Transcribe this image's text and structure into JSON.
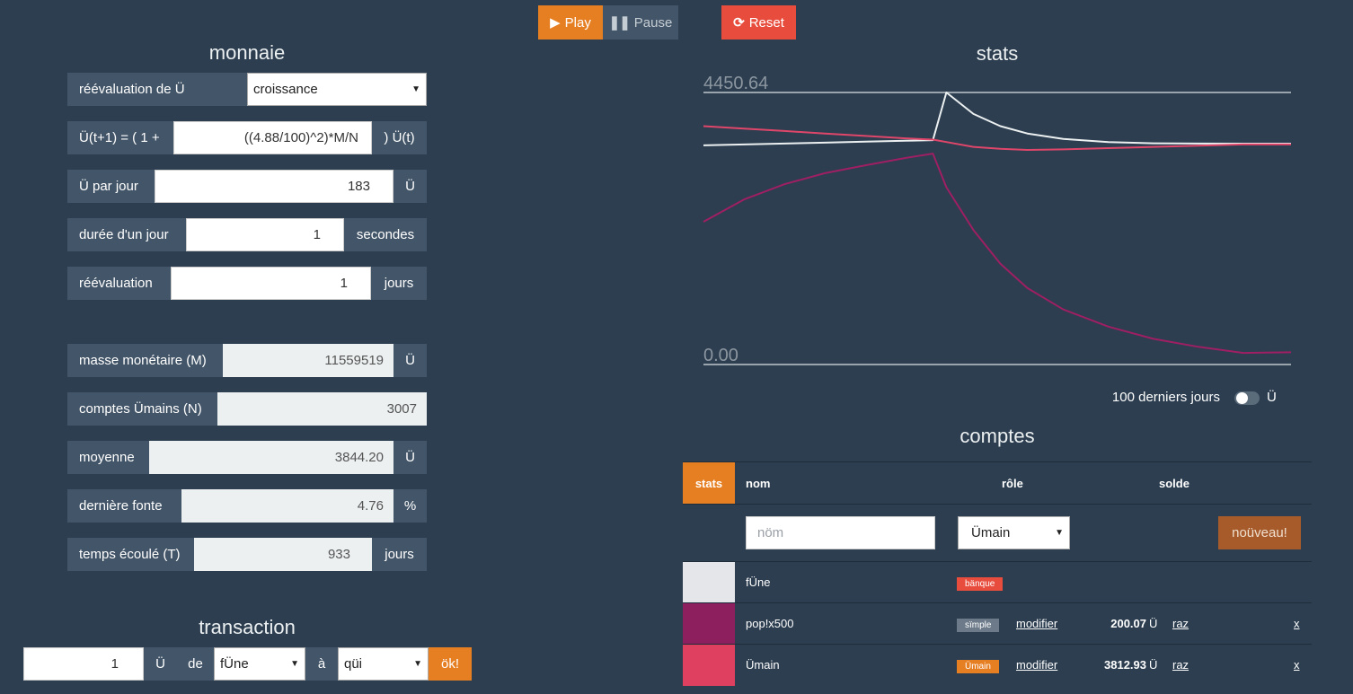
{
  "controls": {
    "play_label": "Play",
    "pause_label": "Pause",
    "reset_label": "Reset",
    "play_color": "#e67e22",
    "pause_color": "#435568",
    "reset_color": "#e74c3c"
  },
  "monnaie": {
    "title": "monnaie",
    "reevaluation_de_u": {
      "label": "réévaluation de Ü",
      "value": "croissance"
    },
    "formula": {
      "prefix": "Ü(t+1) = ( 1 +",
      "value": "((4.88/100)^2)*M/N",
      "suffix": ") Ü(t)"
    },
    "u_par_jour": {
      "label": "Ü par jour",
      "value": "183",
      "unit": "Ü"
    },
    "duree_jour": {
      "label": "durée d'un jour",
      "value": "1",
      "unit": "secondes"
    },
    "reevaluation": {
      "label": "réévaluation",
      "value": "1",
      "unit": "jours"
    },
    "masse": {
      "label": "masse monétaire (M)",
      "value": "11559519",
      "unit": "Ü"
    },
    "comptes": {
      "label": "comptes Ümains (N)",
      "value": "3007"
    },
    "moyenne": {
      "label": "moyenne",
      "value": "3844.20",
      "unit": "Ü"
    },
    "fonte": {
      "label": "dernière fonte",
      "value": "4.76",
      "unit": "%"
    },
    "temps": {
      "label": "temps écoulé (T)",
      "value": "933",
      "unit": "jours"
    }
  },
  "transaction": {
    "title": "transaction",
    "amount": "1",
    "unit": "Ü",
    "de_label": "de",
    "from": "fÜne",
    "a_label": "à",
    "to": "qüi",
    "ok_label": "ök!"
  },
  "stats": {
    "title": "stats",
    "toggle_label": "100 derniers jours",
    "toggle_unit": "Ü",
    "toggle_on": false
  },
  "chart_data": {
    "type": "line",
    "y_labels": [
      "4450.64",
      "0.00"
    ],
    "ylim": [
      0,
      4450.64
    ],
    "x": [
      0,
      45,
      90,
      135,
      180,
      225,
      255,
      270,
      300,
      330,
      360,
      400,
      450,
      500,
      550,
      600,
      653
    ],
    "series": [
      {
        "color": "#ecf0f1",
        "values": [
          3586,
          3600,
          3615,
          3630,
          3645,
          3660,
          3670,
          4450,
          4100,
          3900,
          3780,
          3690,
          3640,
          3620,
          3615,
          3614,
          3614
        ]
      },
      {
        "color": "#e0466a",
        "values": [
          3900,
          3860,
          3820,
          3780,
          3740,
          3700,
          3680,
          3640,
          3560,
          3530,
          3510,
          3520,
          3540,
          3560,
          3580,
          3600,
          3600
        ]
      },
      {
        "color": "#9e1f63",
        "values": [
          2335,
          2700,
          2950,
          3130,
          3260,
          3380,
          3450,
          2900,
          2200,
          1650,
          1250,
          900,
          620,
          420,
          290,
          190,
          200
        ]
      }
    ]
  },
  "comptes": {
    "title": "comptes",
    "headers": {
      "stats": "stats",
      "nom": "nom",
      "role": "rôle",
      "solde": "solde"
    },
    "new_row": {
      "nom_placeholder": "nöm",
      "role": "Ümain",
      "button": "noüveau!"
    },
    "rows": [
      {
        "color": "#e5e6ea",
        "nom": "fÜne",
        "role": "bänque",
        "role_color": "#e74c3c",
        "modifier": "",
        "solde": "",
        "raz": "",
        "x": ""
      },
      {
        "color": "#8e1f5f",
        "nom": "pop!x500",
        "role": "sïmple",
        "role_color": "#6c7a89",
        "modifier": "modifier",
        "solde": "200.07",
        "unit": "Ü",
        "raz": "raz",
        "x": "x"
      },
      {
        "color": "#e04060",
        "nom": "Ümain",
        "role": "Ümain",
        "role_color": "#e67e22",
        "modifier": "modifier",
        "solde": "3812.93",
        "unit": "Ü",
        "raz": "raz",
        "x": "x"
      }
    ]
  }
}
